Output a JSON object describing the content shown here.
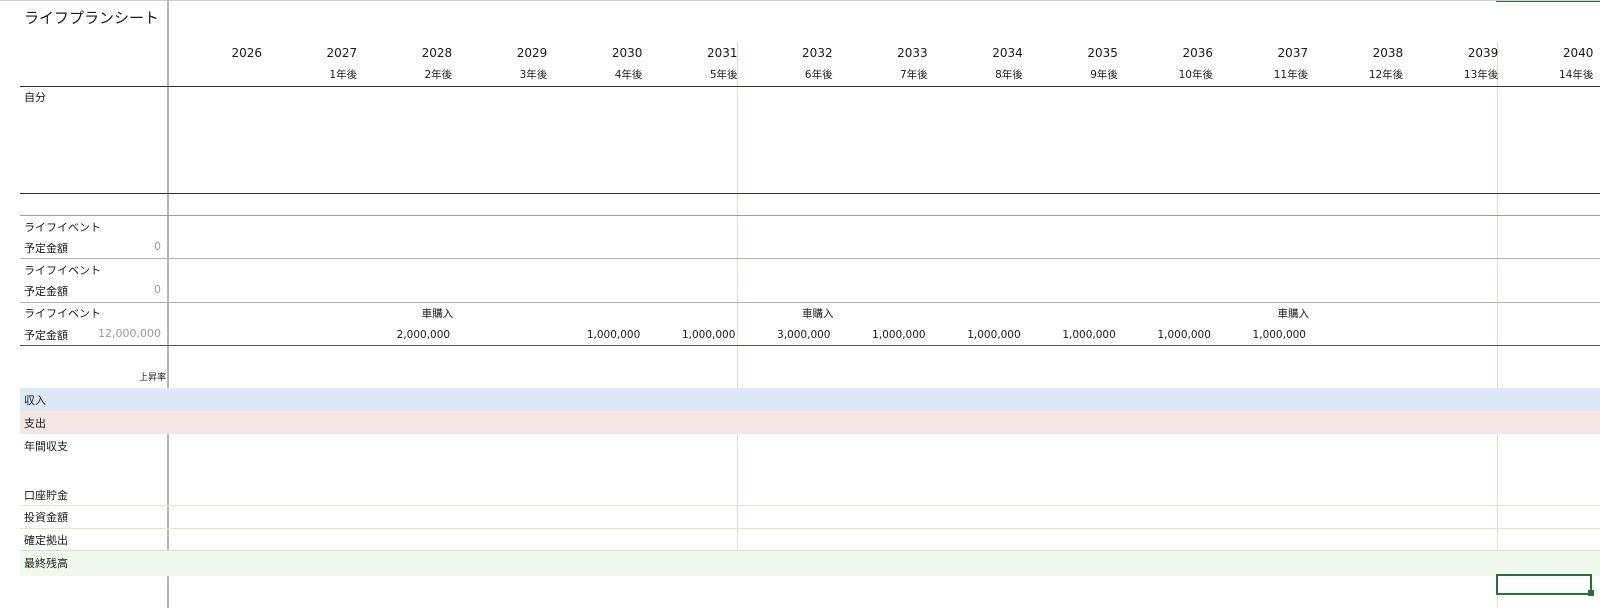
{
  "sheet": {
    "title": "ライフプランシート",
    "years": [
      {
        "year": "2026",
        "ago": ""
      },
      {
        "year": "2027",
        "ago": "1年後"
      },
      {
        "year": "2028",
        "ago": "2年後"
      },
      {
        "year": "2029",
        "ago": "3年後"
      },
      {
        "year": "2030",
        "ago": "4年後"
      },
      {
        "year": "2031",
        "ago": "5年後"
      },
      {
        "year": "2032",
        "ago": "6年後"
      },
      {
        "year": "2033",
        "ago": "7年後"
      },
      {
        "year": "2034",
        "ago": "8年後"
      },
      {
        "year": "2035",
        "ago": "9年後"
      },
      {
        "year": "2036",
        "ago": "10年後"
      },
      {
        "year": "2037",
        "ago": "11年後"
      },
      {
        "year": "2038",
        "ago": "12年後"
      },
      {
        "year": "2039",
        "ago": "13年後"
      },
      {
        "year": "2040",
        "ago": "14年後"
      }
    ],
    "self_label": "自分",
    "events": [
      {
        "event_label": "ライフイベント",
        "amount_label": "予定金額",
        "amount_total": "0"
      },
      {
        "event_label": "ライフイベント",
        "amount_label": "予定金額",
        "amount_total": "0"
      },
      {
        "event_label": "ライフイベント",
        "amount_label": "予定金額",
        "amount_total": "12,000,000"
      }
    ],
    "event3_cells": {
      "names": [
        "",
        "車購入",
        "",
        "",
        "",
        "車購入",
        "",
        "",
        "",
        "",
        "車購入",
        "",
        "",
        "",
        ""
      ],
      "amounts": [
        "",
        "2,000,000",
        "",
        "1,000,000",
        "1,000,000",
        "3,000,000",
        "1,000,000",
        "1,000,000",
        "1,000,000",
        "1,000,000",
        "1,000,000",
        "",
        "",
        "",
        ""
      ]
    },
    "rise_rate_label": "上昇率",
    "rows": {
      "income": "収入",
      "expense": "支出",
      "annual_balance": "年間収支",
      "account_savings": "口座貯金",
      "investment": "投資金額",
      "defined_contribution": "確定拠出",
      "final_balance": "最終残高"
    },
    "colors": {
      "income_band": "#dde8f6",
      "expense_band": "#f5e6e5",
      "final_band": "#f1f8ee",
      "selection": "#2e6b3e",
      "green_line": "#cfe8c4"
    }
  }
}
